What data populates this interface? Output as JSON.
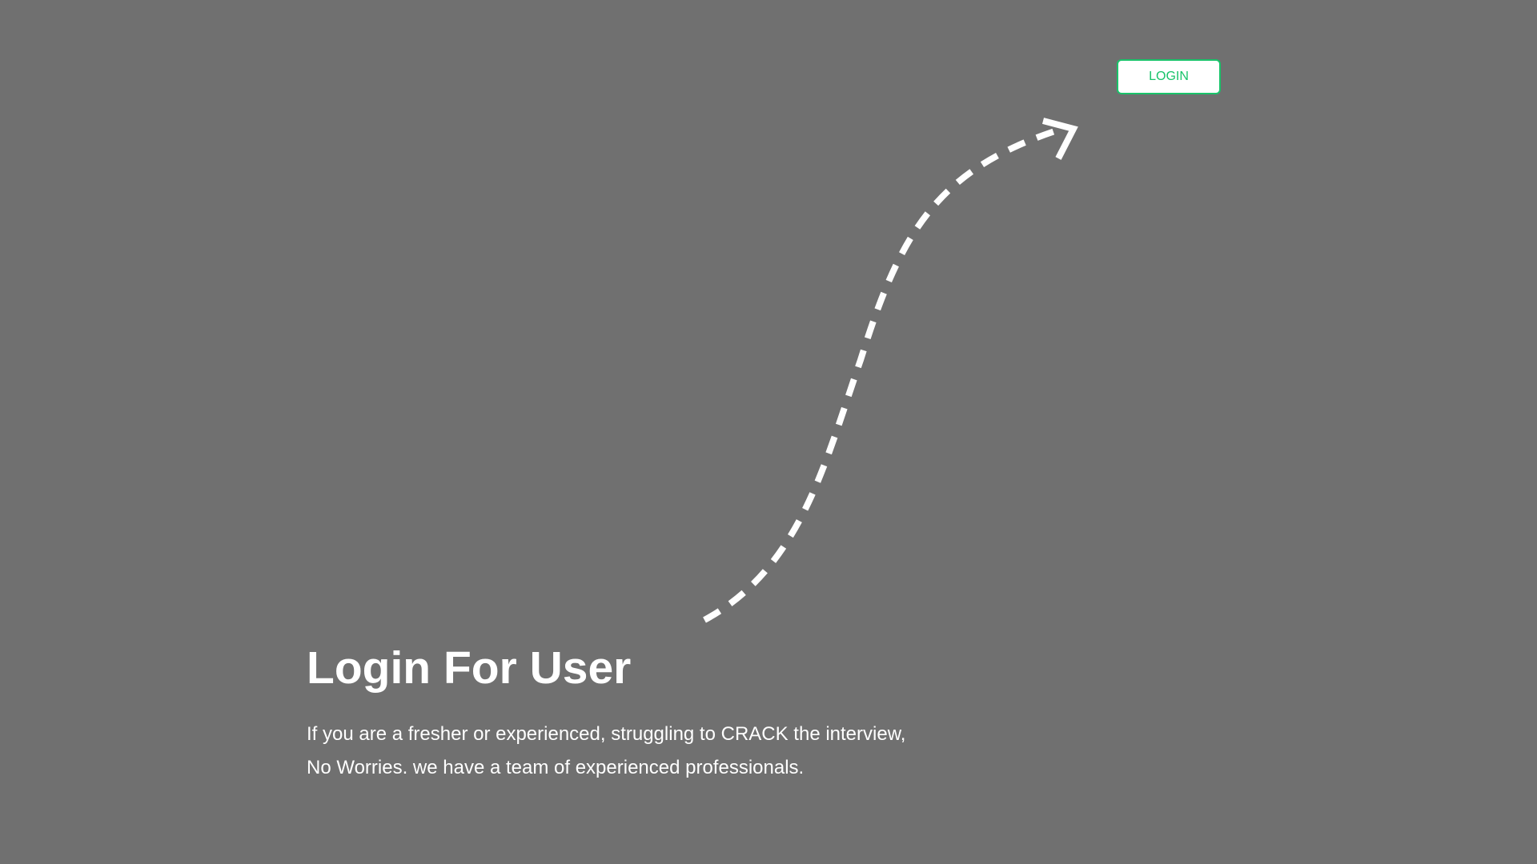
{
  "header": {
    "login_label": "LOGIN"
  },
  "hero": {
    "title": "Login For User",
    "line1": "If you are a fresher or experienced, struggling to CRACK the interview,",
    "line2": "No Worries. we have a team of experienced professionals."
  },
  "colors": {
    "background": "#707070",
    "accent": "#19c36a",
    "text": "#ffffff"
  },
  "icons": {
    "arrow": "dashed-curved-arrow-icon"
  }
}
